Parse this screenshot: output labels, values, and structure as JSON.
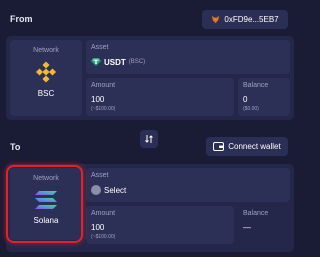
{
  "from": {
    "section_label": "From",
    "wallet_address": "0xFD9e...5EB7",
    "network": {
      "label": "Network",
      "name": "BSC"
    },
    "asset": {
      "label": "Asset",
      "symbol": "USDT",
      "chain_tag": "(BSC)"
    },
    "amount": {
      "label": "Amount",
      "value": "100",
      "fiat": "(~$100.00)"
    },
    "balance": {
      "label": "Balance",
      "value": "0",
      "fiat": "($0.00)"
    }
  },
  "to": {
    "section_label": "To",
    "connect_label": "Connect wallet",
    "network": {
      "label": "Network",
      "name": "Solana"
    },
    "asset": {
      "label": "Asset",
      "placeholder": "Select"
    },
    "amount": {
      "label": "Amount",
      "value": "100",
      "fiat": "(~$100.00)"
    },
    "balance": {
      "label": "Balance",
      "value": "—"
    }
  },
  "icons": {
    "wallet": "metamask-fox-icon",
    "bsc": "bnb-chain-icon",
    "usdt": "tether-icon",
    "swap": "swap-arrows-icon",
    "connect": "wallet-icon",
    "solana": "solana-icon",
    "select": "placeholder-token-icon"
  },
  "colors": {
    "background": "#1a1b35",
    "panel": "#24264a",
    "field": "#2d3056",
    "bsc": "#f3ba2f",
    "usdt": "#26a17b",
    "highlight": "#e0232b"
  }
}
